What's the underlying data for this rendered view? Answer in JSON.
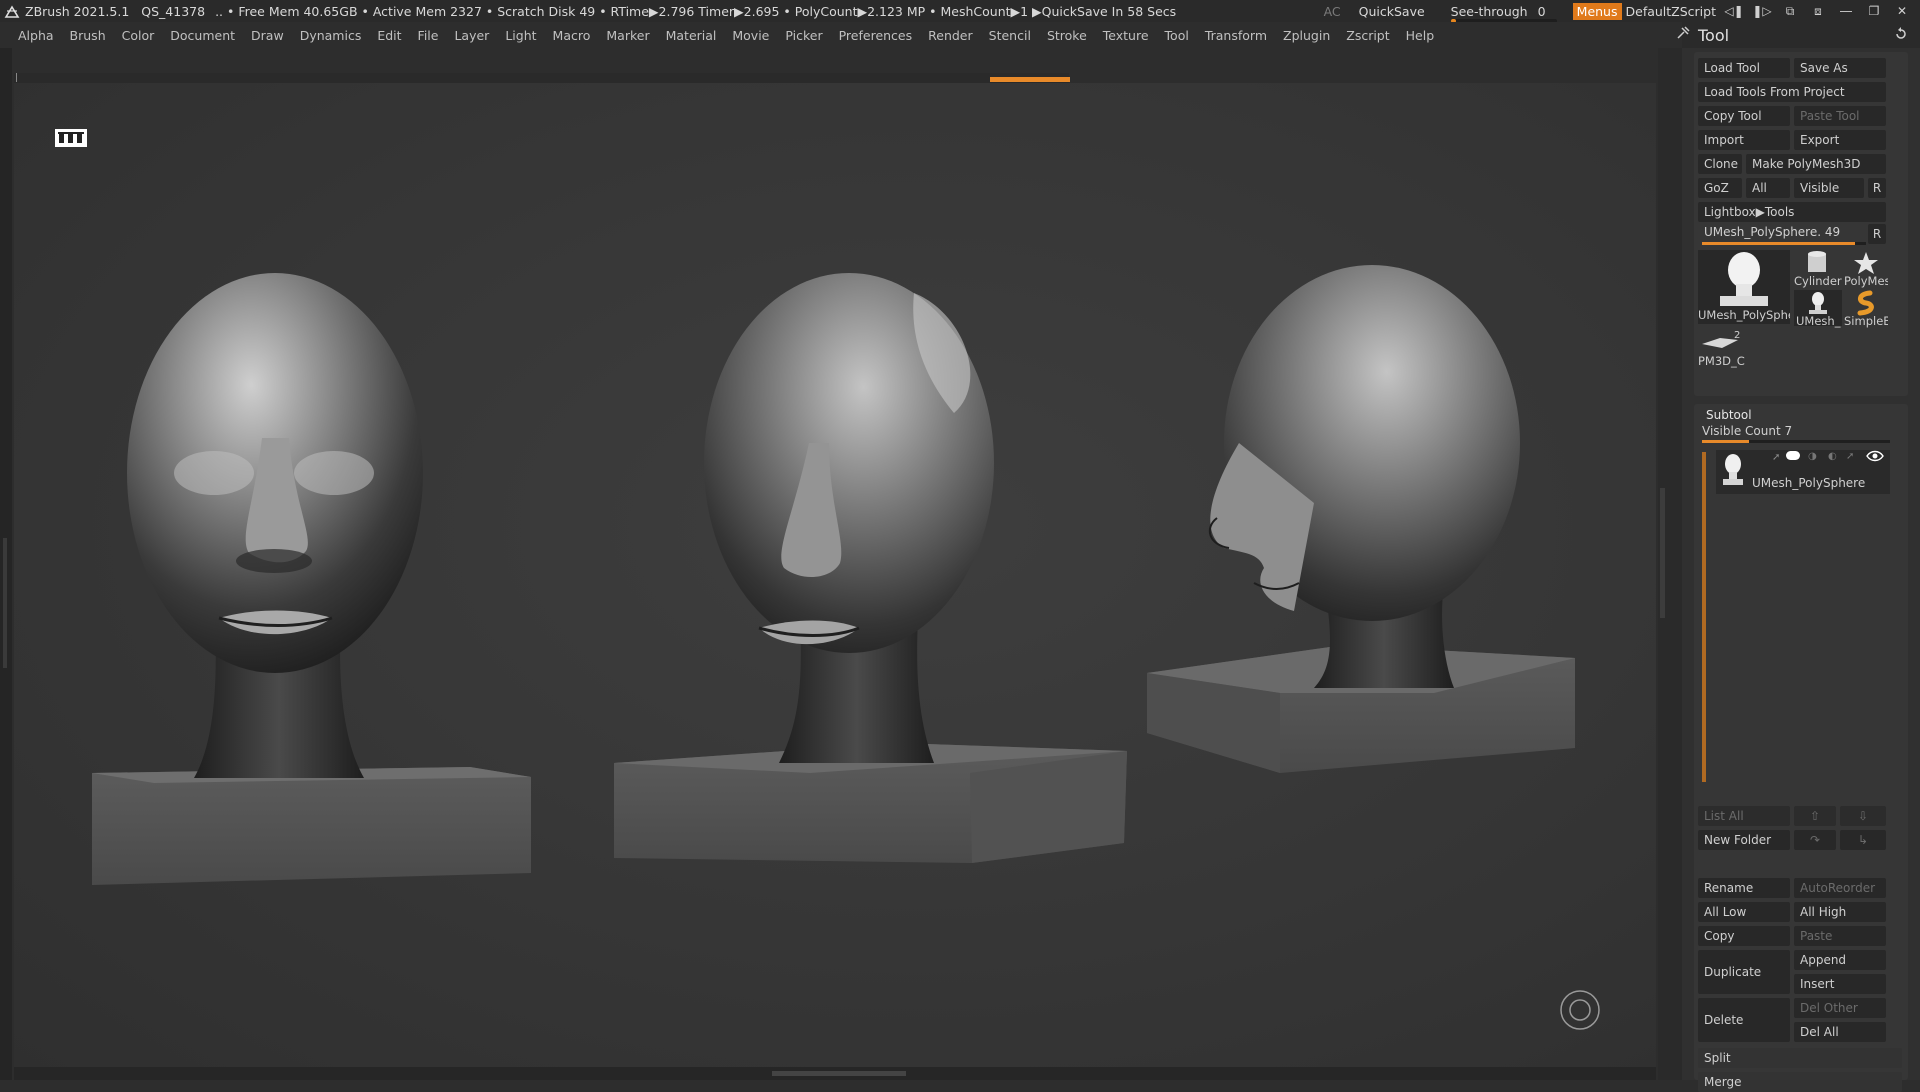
{
  "titlebar": {
    "app": "ZBrush 2021.5.1",
    "file": "QS_41378",
    "stats": ".. • Free Mem 40.65GB • Active Mem 2327 • Scratch Disk 49 •  RTime▶2.796 Timer▶2.695 • PolyCount▶2.123 MP  • MeshCount▶1  ▶QuickSave In 58 Secs",
    "ac": "AC",
    "quicksave": "QuickSave",
    "seethrough_label": "See-through",
    "seethrough_value": "0",
    "seethrough_level": 0.05,
    "menus": "Menus",
    "default_script": "DefaultZScript",
    "accent": "#e07a1b"
  },
  "menubar": [
    "Alpha",
    "Brush",
    "Color",
    "Document",
    "Draw",
    "Dynamics",
    "Edit",
    "File",
    "Layer",
    "Light",
    "Macro",
    "Marker",
    "Material",
    "Movie",
    "Picker",
    "Preferences",
    "Render",
    "Stencil",
    "Stroke",
    "Texture",
    "Tool",
    "Transform",
    "Zplugin",
    "Zscript",
    "Help"
  ],
  "tool_panel": {
    "title": "Tool",
    "load_tool": "Load Tool",
    "save_as": "Save As",
    "load_from_project": "Load Tools From Project",
    "copy_tool": "Copy Tool",
    "paste_tool": "Paste Tool",
    "import": "Import",
    "export": "Export",
    "clone": "Clone",
    "make_polymesh": "Make PolyMesh3D",
    "goz": "GoZ",
    "all": "All",
    "visible": "Visible",
    "r": "R",
    "lightbox_tools": "Lightbox▶Tools",
    "current_tool": "UMesh_PolySphere. 49",
    "current_tool_level": 0.93,
    "thumbs": {
      "umesh_main": "UMesh_PolySphe",
      "cylinder": "Cylinder",
      "polymesh": "PolyMes",
      "umesh_small": "UMesh_",
      "simpleb": "SimpleB",
      "pm3d": "PM3D_C",
      "pm3d_count": "2"
    }
  },
  "subtool": {
    "title": "Subtool",
    "visible_count": "Visible Count 7",
    "visible_count_level": 0.25,
    "item_name": "UMesh_PolySphere",
    "list_all": "List All",
    "new_folder": "New Folder",
    "rename": "Rename",
    "autoreorder": "AutoReorder",
    "all_low": "All Low",
    "all_high": "All High",
    "copy": "Copy",
    "paste": "Paste",
    "duplicate": "Duplicate",
    "append": "Append",
    "insert": "Insert",
    "delete": "Delete",
    "del_other": "Del Other",
    "del_all": "Del All",
    "split": "Split",
    "merge": "Merge"
  }
}
